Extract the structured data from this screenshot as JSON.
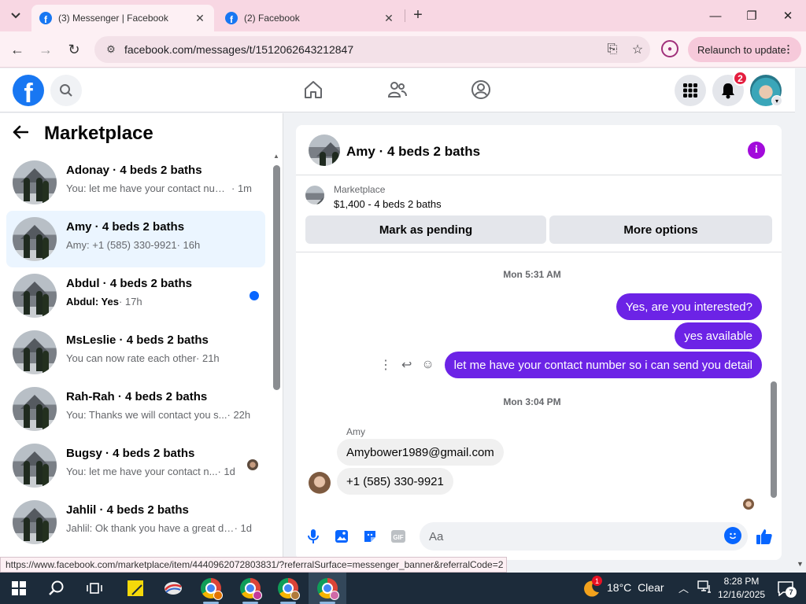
{
  "browser": {
    "tabs": [
      {
        "title": "(3) Messenger | Facebook",
        "active": true
      },
      {
        "title": "(2) Facebook",
        "active": false
      }
    ],
    "url": "facebook.com/messages/t/1512062643212847",
    "relaunch_label": "Relaunch to update",
    "status_url": "https://www.facebook.com/marketplace/item/4440962072803831/?referralSurface=messenger_banner&referralCode=2"
  },
  "fbnav": {
    "notification_count": "2"
  },
  "left_panel": {
    "title": "Marketplace",
    "conversations": [
      {
        "name": "Adonay · 4 beds 2 baths",
        "preview": "You: let me have your contact num...",
        "time": " · 1m",
        "unread": false,
        "selected": false
      },
      {
        "name": "Amy · 4 beds 2 baths",
        "preview": "Amy: +1 (585) 330-9921",
        "time": " · 16h",
        "unread": false,
        "selected": true
      },
      {
        "name": "Abdul · 4 beds 2 baths",
        "preview": "Abdul: Yes",
        "time": " · 17h",
        "unread": true,
        "selected": false
      },
      {
        "name": "MsLeslie · 4 beds 2 baths",
        "preview": "You can now rate each other",
        "time": " · 21h",
        "unread": false,
        "selected": false
      },
      {
        "name": "Rah-Rah · 4 beds 2 baths",
        "preview": "You: Thanks we will contact you s...",
        "time": " · 22h",
        "unread": false,
        "selected": false
      },
      {
        "name": "Bugsy · 4 beds 2 baths",
        "preview": "You: let me have your contact n...",
        "time": " · 1d",
        "unread": false,
        "selected": false
      },
      {
        "name": "Jahlil · 4 beds 2 baths",
        "preview": "Jahlil: Ok thank you have a great day",
        "time": " · 1d",
        "unread": false,
        "selected": false
      }
    ]
  },
  "chat": {
    "title": "Amy · 4 beds 2 baths",
    "banner": {
      "source": "Marketplace",
      "listing": "$1,400 - 4 beds 2 baths",
      "pending_label": "Mark as pending",
      "options_label": "More options"
    },
    "timestamp1": "Mon 5:31 AM",
    "outgoing": [
      "Yes, are you interested?",
      "yes available",
      "let me have your contact number so i can send you detail"
    ],
    "timestamp2": "Mon 3:04 PM",
    "incoming_sender": "Amy",
    "incoming": [
      "Amybower1989@gmail.com",
      "+1 (585) 330-9921"
    ],
    "input_placeholder": "Aa"
  },
  "taskbar": {
    "weather_temp": "18°C",
    "weather_desc": "Clear",
    "weather_badge": "1",
    "time": "8:28 PM",
    "date": "12/16/2025",
    "notification_count": "7"
  },
  "colors": {
    "facebook_blue": "#1877f2",
    "messenger_purple": "#6c23e6",
    "unread_blue": "#0866ff",
    "badge_red": "#e41e3f"
  }
}
